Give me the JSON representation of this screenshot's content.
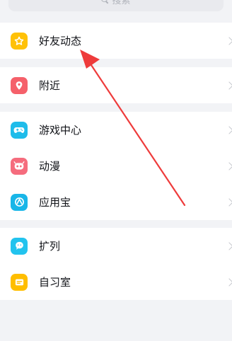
{
  "search": {
    "label": "搜索"
  },
  "groups": [
    {
      "items": [
        {
          "label": "好友动态",
          "icon": "star-icon",
          "color": "#ffc107"
        }
      ]
    },
    {
      "items": [
        {
          "label": "附近",
          "icon": "location-pin-icon",
          "color": "#f5606a"
        }
      ]
    },
    {
      "items": [
        {
          "label": "游戏中心",
          "icon": "gamepad-icon",
          "color": "#1fbcea"
        },
        {
          "label": "动漫",
          "icon": "anime-face-icon",
          "color": "#f56c7d"
        },
        {
          "label": "应用宝",
          "icon": "app-store-icon",
          "color": "#18b6e8"
        }
      ]
    },
    {
      "items": [
        {
          "label": "扩列",
          "icon": "chat-bubble-icon",
          "color": "#22c3ee"
        },
        {
          "label": "自习室",
          "icon": "study-room-icon",
          "color": "#ffbe00"
        }
      ]
    }
  ],
  "annotation": {
    "arrow_color": "#ee3b3b",
    "icon": "red-arrow-annotation-icon"
  }
}
